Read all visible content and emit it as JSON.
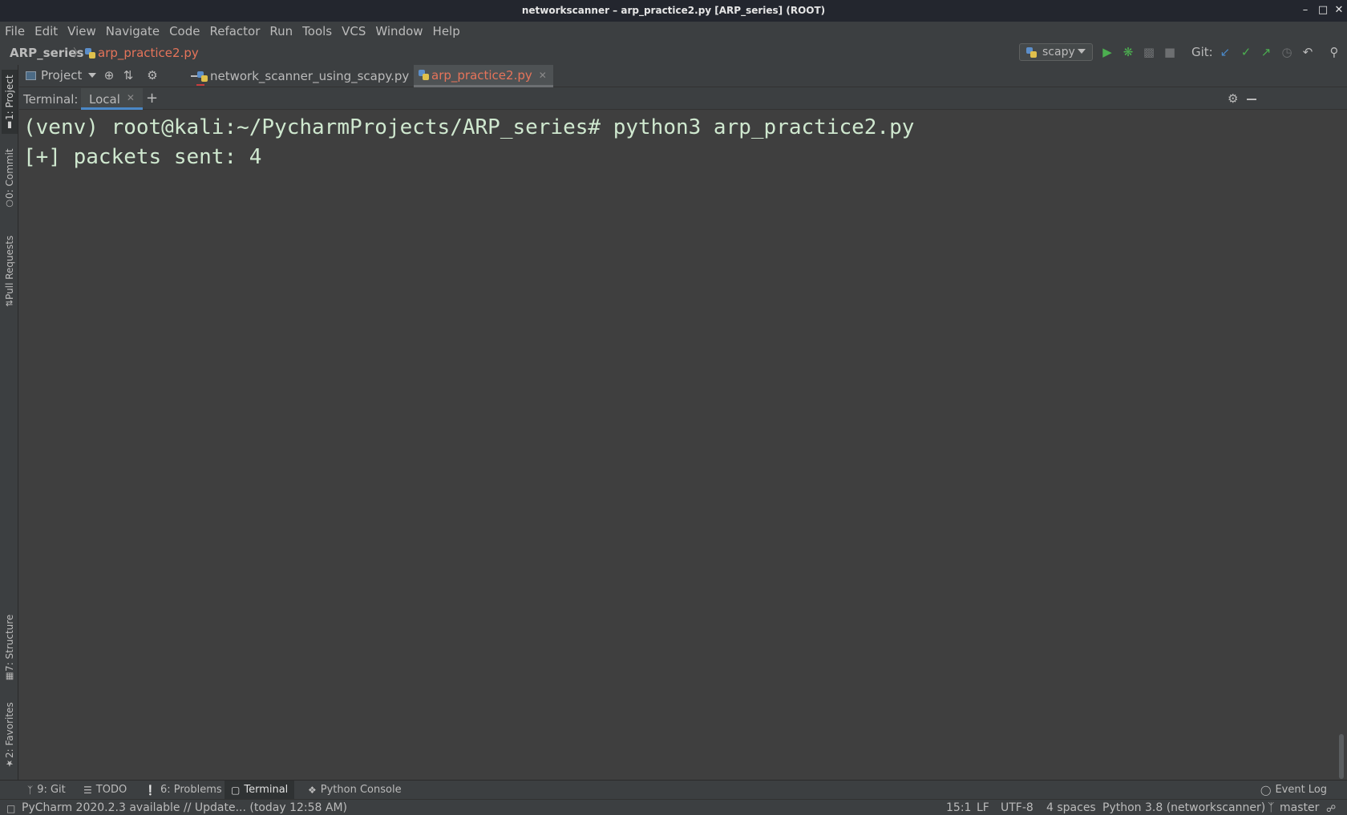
{
  "window": {
    "title": "networkscanner – arp_practice2.py [ARP_series] (ROOT)"
  },
  "menu": [
    "File",
    "Edit",
    "View",
    "Navigate",
    "Code",
    "Refactor",
    "Run",
    "Tools",
    "VCS",
    "Window",
    "Help"
  ],
  "breadcrumb": {
    "root": "ARP_series",
    "separator": "〉",
    "file": "arp_practice2.py"
  },
  "run_config": {
    "name": "scapy"
  },
  "git": {
    "label": "Git:"
  },
  "left_stripe": {
    "project": "1: Project",
    "commit": "0: Commit",
    "pull_requests": "Pull Requests",
    "structure": "7: Structure",
    "favorites": "2: Favorites"
  },
  "project_panel": {
    "label": "Project"
  },
  "editor_tabs": [
    {
      "label": "network_scanner_using_scapy.py",
      "active": false
    },
    {
      "label": "arp_practice2.py",
      "active": true
    }
  ],
  "terminal": {
    "label": "Terminal:",
    "tab": "Local",
    "lines": [
      "(venv) root@kali:~/PycharmProjects/ARP_series# python3 arp_practice2.py",
      "[+] packets sent: 4"
    ]
  },
  "bottom_tabs": [
    {
      "icon": "git-branch-icon",
      "label": "9: Git"
    },
    {
      "icon": "todo-icon",
      "label": "TODO"
    },
    {
      "icon": "problems-icon",
      "label": "6: Problems"
    },
    {
      "icon": "terminal-icon",
      "label": "Terminal",
      "active": true
    },
    {
      "icon": "python-console-icon",
      "label": "Python Console"
    }
  ],
  "event_log": "Event Log",
  "status": {
    "message": "PyCharm 2020.2.3 available // Update... (today 12:58 AM)",
    "position": "15:1",
    "line_ending": "LF",
    "encoding": "UTF-8",
    "indent": "4 spaces",
    "interpreter": "Python 3.8 (networkscanner)",
    "branch": "master"
  },
  "colors": {
    "accent_blue": "#4a88c7",
    "active_file": "#e6745a",
    "run_green": "#4caf50",
    "terminal_text": "#cfe8cf"
  }
}
